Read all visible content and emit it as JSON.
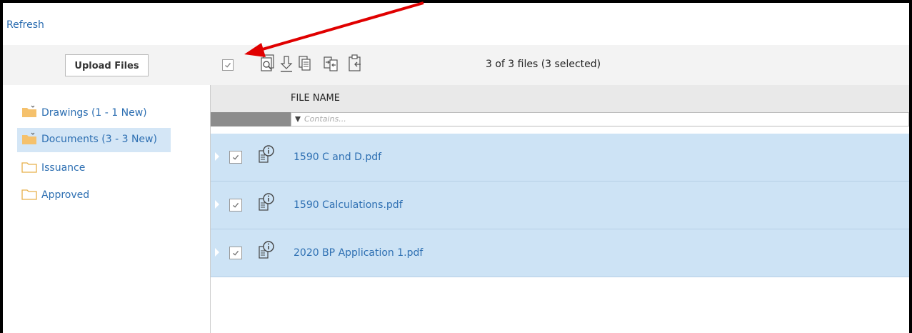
{
  "header": {
    "refresh_label": "Refresh"
  },
  "toolbar": {
    "upload_label": "Upload Files",
    "file_count": "3 of 3 files (3 selected)",
    "select_all_checked": true,
    "icons": [
      "preview-icon",
      "download-icon",
      "copy-icon",
      "move-icon",
      "clipboard-icon"
    ]
  },
  "sidebar": {
    "folders": [
      {
        "label": "Drawings (1 - 1 New)",
        "icon": "open-folder-icon",
        "selected": false
      },
      {
        "label": "Documents (3 - 3 New)",
        "icon": "open-folder-icon",
        "selected": true
      },
      {
        "label": "Issuance",
        "icon": "folder-icon",
        "selected": false
      },
      {
        "label": "Approved",
        "icon": "folder-icon",
        "selected": false
      }
    ]
  },
  "grid": {
    "column_header": "FILE NAME",
    "filter_placeholder": "Contains...",
    "rows": [
      {
        "name": "1590 C and D.pdf",
        "checked": true
      },
      {
        "name": "1590 Calculations.pdf",
        "checked": true
      },
      {
        "name": "2020 BP Application 1.pdf",
        "checked": true
      }
    ]
  },
  "colors": {
    "accent": "#2d6fb2",
    "selected_row": "#cde3f5",
    "selected_folder": "#d4e6f6",
    "folder_fill": "#f5c16c",
    "annotation_arrow": "#e00000"
  }
}
